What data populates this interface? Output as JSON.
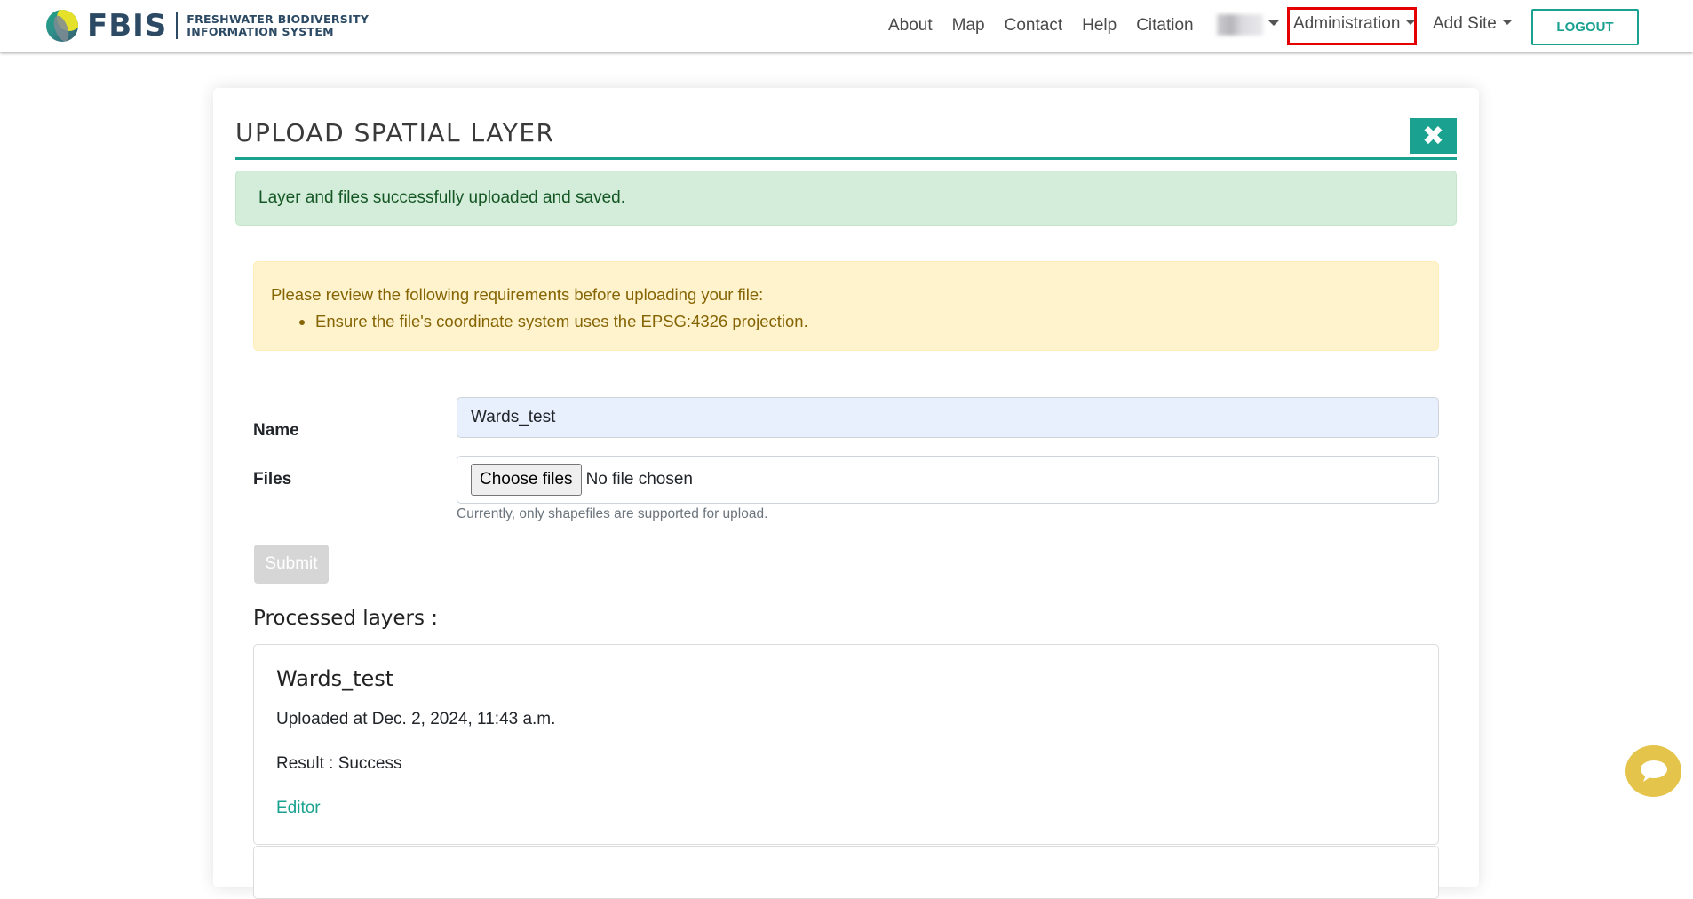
{
  "navbar": {
    "logo_name": "FBIS",
    "logo_sub_line1": "FRESHWATER BIODIVERSITY",
    "logo_sub_line2": "INFORMATION SYSTEM",
    "links": [
      {
        "label": "About"
      },
      {
        "label": "Map"
      },
      {
        "label": "Contact"
      },
      {
        "label": "Help"
      },
      {
        "label": "Citation"
      }
    ],
    "user_menu_label": "",
    "administration_label": "Administration",
    "add_site_label": "Add Site",
    "logout_label": "LOGOUT",
    "highlight_color": "#e50000"
  },
  "page": {
    "title": "UPLOAD SPATIAL LAYER",
    "close_icon": "close-icon",
    "success_message": "Layer and files successfully uploaded and saved.",
    "requirements_intro": "Please review the following requirements before uploading your file:",
    "requirements": [
      "Ensure the file's coordinate system uses the EPSG:4326 projection."
    ],
    "form": {
      "name_label": "Name",
      "name_value": "Wards_test",
      "files_label": "Files",
      "choose_files_label": "Choose files",
      "no_file_text": "No file chosen",
      "files_help": "Currently, only shapefiles are supported for upload.",
      "submit_label": "Submit"
    },
    "processed_heading": "Processed layers :",
    "processed_layers": [
      {
        "name": "Wards_test",
        "uploaded_at": "Uploaded at Dec. 2, 2024, 11:43 a.m.",
        "result": "Result : Success",
        "editor_label": "Editor"
      }
    ]
  },
  "chat": {
    "icon": "chat-bubble-icon"
  },
  "colors": {
    "brand_teal": "#1aa190",
    "brand_navy": "#2c4a64",
    "success_bg": "#d4edda",
    "warning_bg": "#fff3cd",
    "chat_yellow": "#e5c44c"
  }
}
